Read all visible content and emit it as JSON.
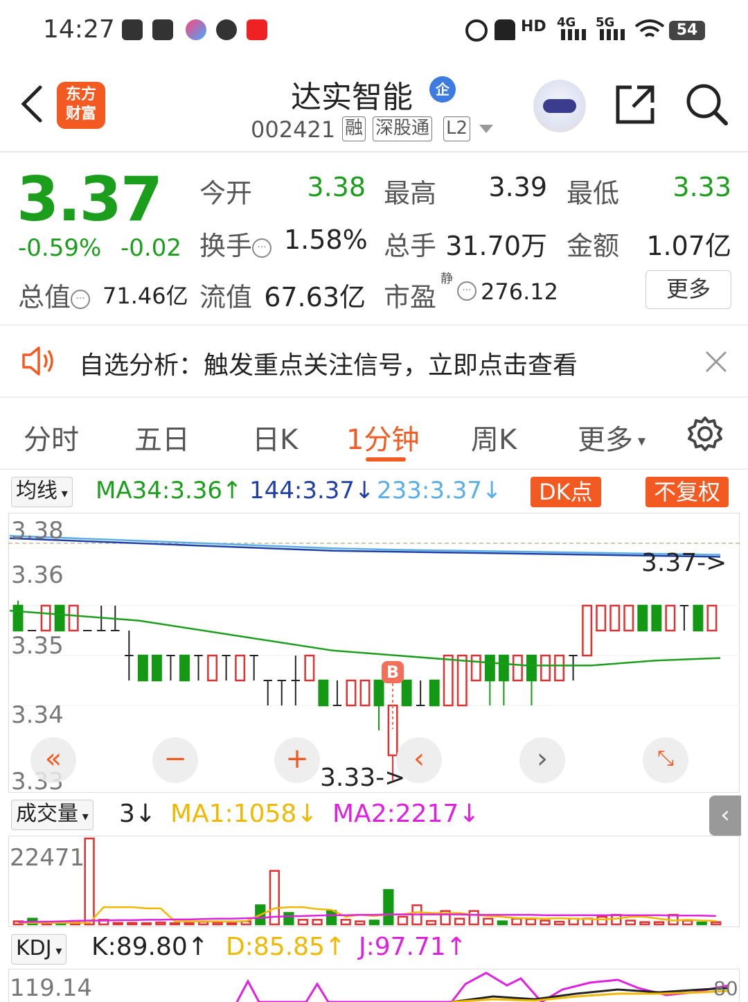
{
  "status_bar": {
    "time": "14:27",
    "battery": "54",
    "network_labels": [
      "HD",
      "4G",
      "5G"
    ],
    "icons": [
      "tiktok-icon",
      "play-icon",
      "cloud-icon",
      "wechat-icon",
      "app-red-icon",
      "alarm-icon",
      "mute-icon",
      "hd-icon",
      "signal-4g-icon",
      "signal-5g-icon",
      "wifi-icon",
      "battery-icon"
    ]
  },
  "header": {
    "logo_text": [
      "东方",
      "财富"
    ],
    "stock_name": "达实智能",
    "enterprise_badge": "企",
    "stock_code": "002421",
    "tags": [
      "融",
      "深股通",
      "L2"
    ],
    "icons": [
      "back-arrow-icon",
      "robot-assistant-icon",
      "share-icon",
      "search-icon"
    ]
  },
  "quote": {
    "price": "3.37",
    "change_pct": "-0.59%",
    "change_amt": "-0.02",
    "open_label": "今开",
    "open": "3.38",
    "high_label": "最高",
    "high": "3.39",
    "low_label": "最低",
    "low": "3.33",
    "turnover_label": "换手",
    "turnover": "1.58%",
    "volume_label": "总手",
    "volume": "31.70万",
    "amount_label": "金额",
    "amount": "1.07亿",
    "mcap_label": "总值",
    "mcap": "71.46亿",
    "float_label": "流值",
    "float_mcap": "67.63亿",
    "pe_label": "市盈",
    "pe_sup": "静",
    "pe": "276.12",
    "more_btn": "更多"
  },
  "notice": {
    "text": "自选分析：触发重点关注信号，立即点击查看",
    "icons": [
      "speaker-icon",
      "close-icon"
    ]
  },
  "tabs": {
    "items": [
      "分时",
      "五日",
      "日K",
      "1分钟",
      "周K",
      "更多"
    ],
    "active": "1分钟",
    "settings_icon": "gear-icon"
  },
  "ma_row": {
    "selector": "均线",
    "ma34": "MA34:3.36↑",
    "ma144": "144:3.37↓",
    "ma233": "233:3.37↓",
    "dk_btn": "DK点",
    "adjust_btn": "不复权",
    "colors": {
      "ma34": "#1b9e1b",
      "ma144": "#1f3ea6",
      "ma233": "#5aaee8",
      "up": "#e03030",
      "down": "#139913",
      "accent": "#f25a22"
    }
  },
  "chart_data": [
    {
      "type": "candlestick",
      "yticks": [
        "3.38",
        "3.36",
        "3.35",
        "3.34",
        "3.33"
      ],
      "ylim": [
        3.33,
        3.38
      ],
      "last_price_label": "3.37->",
      "low_price_label": "3.33->",
      "buy_marker": "B",
      "candles": [
        {
          "o": 3.365,
          "c": 3.36,
          "h": 3.366,
          "l": 3.36
        },
        {
          "o": 3.36,
          "c": 3.36,
          "h": 3.36,
          "l": 3.36
        },
        {
          "o": 3.36,
          "c": 3.365,
          "h": 3.365,
          "l": 3.36
        },
        {
          "o": 3.365,
          "c": 3.36,
          "h": 3.365,
          "l": 3.36
        },
        {
          "o": 3.36,
          "c": 3.365,
          "h": 3.365,
          "l": 3.36
        },
        {
          "o": 3.36,
          "c": 3.36,
          "h": 3.36,
          "l": 3.36
        },
        {
          "o": 3.36,
          "c": 3.36,
          "h": 3.365,
          "l": 3.36
        },
        {
          "o": 3.36,
          "c": 3.36,
          "h": 3.365,
          "l": 3.36
        },
        {
          "o": 3.355,
          "c": 3.355,
          "h": 3.36,
          "l": 3.35
        },
        {
          "o": 3.355,
          "c": 3.35,
          "h": 3.355,
          "l": 3.35
        },
        {
          "o": 3.355,
          "c": 3.35,
          "h": 3.355,
          "l": 3.35
        },
        {
          "o": 3.355,
          "c": 3.355,
          "h": 3.355,
          "l": 3.35
        },
        {
          "o": 3.355,
          "c": 3.35,
          "h": 3.355,
          "l": 3.35
        },
        {
          "o": 3.355,
          "c": 3.355,
          "h": 3.355,
          "l": 3.35
        },
        {
          "o": 3.35,
          "c": 3.355,
          "h": 3.355,
          "l": 3.35
        },
        {
          "o": 3.355,
          "c": 3.355,
          "h": 3.355,
          "l": 3.35
        },
        {
          "o": 3.35,
          "c": 3.355,
          "h": 3.355,
          "l": 3.35
        },
        {
          "o": 3.355,
          "c": 3.355,
          "h": 3.355,
          "l": 3.35
        },
        {
          "o": 3.35,
          "c": 3.35,
          "h": 3.35,
          "l": 3.345
        },
        {
          "o": 3.35,
          "c": 3.35,
          "h": 3.35,
          "l": 3.345
        },
        {
          "o": 3.35,
          "c": 3.35,
          "h": 3.355,
          "l": 3.345
        },
        {
          "o": 3.35,
          "c": 3.355,
          "h": 3.355,
          "l": 3.35
        },
        {
          "o": 3.35,
          "c": 3.345,
          "h": 3.35,
          "l": 3.345
        },
        {
          "o": 3.345,
          "c": 3.345,
          "h": 3.35,
          "l": 3.345
        },
        {
          "o": 3.345,
          "c": 3.35,
          "h": 3.35,
          "l": 3.345
        },
        {
          "o": 3.345,
          "c": 3.35,
          "h": 3.35,
          "l": 3.345
        },
        {
          "o": 3.35,
          "c": 3.345,
          "h": 3.35,
          "l": 3.34
        },
        {
          "o": 3.335,
          "c": 3.345,
          "h": 3.345,
          "l": 3.33
        },
        {
          "o": 3.35,
          "c": 3.345,
          "h": 3.35,
          "l": 3.345
        },
        {
          "o": 3.345,
          "c": 3.345,
          "h": 3.35,
          "l": 3.345
        },
        {
          "o": 3.35,
          "c": 3.345,
          "h": 3.35,
          "l": 3.345
        },
        {
          "o": 3.345,
          "c": 3.355,
          "h": 3.355,
          "l": 3.345
        },
        {
          "o": 3.345,
          "c": 3.355,
          "h": 3.355,
          "l": 3.345
        },
        {
          "o": 3.35,
          "c": 3.355,
          "h": 3.355,
          "l": 3.35
        },
        {
          "o": 3.355,
          "c": 3.35,
          "h": 3.355,
          "l": 3.345
        },
        {
          "o": 3.355,
          "c": 3.35,
          "h": 3.355,
          "l": 3.345
        },
        {
          "o": 3.35,
          "c": 3.355,
          "h": 3.355,
          "l": 3.35
        },
        {
          "o": 3.355,
          "c": 3.35,
          "h": 3.355,
          "l": 3.345
        },
        {
          "o": 3.35,
          "c": 3.355,
          "h": 3.355,
          "l": 3.35
        },
        {
          "o": 3.35,
          "c": 3.355,
          "h": 3.355,
          "l": 3.35
        },
        {
          "o": 3.355,
          "c": 3.355,
          "h": 3.355,
          "l": 3.35
        },
        {
          "o": 3.355,
          "c": 3.365,
          "h": 3.365,
          "l": 3.355
        },
        {
          "o": 3.36,
          "c": 3.365,
          "h": 3.365,
          "l": 3.36
        },
        {
          "o": 3.36,
          "c": 3.365,
          "h": 3.365,
          "l": 3.36
        },
        {
          "o": 3.36,
          "c": 3.365,
          "h": 3.365,
          "l": 3.36
        },
        {
          "o": 3.365,
          "c": 3.36,
          "h": 3.365,
          "l": 3.36
        },
        {
          "o": 3.365,
          "c": 3.36,
          "h": 3.365,
          "l": 3.36
        },
        {
          "o": 3.36,
          "c": 3.365,
          "h": 3.365,
          "l": 3.36
        },
        {
          "o": 3.365,
          "c": 3.365,
          "h": 3.365,
          "l": 3.36
        },
        {
          "o": 3.365,
          "c": 3.36,
          "h": 3.365,
          "l": 3.36
        },
        {
          "o": 3.36,
          "c": 3.365,
          "h": 3.365,
          "l": 3.36
        }
      ],
      "ma34_points": [
        3.364,
        3.363,
        3.362,
        3.36,
        3.358,
        3.356,
        3.355,
        3.354,
        3.353,
        3.353,
        3.354,
        3.3545
      ],
      "ma144_points": [
        3.3785,
        3.378,
        3.3775,
        3.377,
        3.3765,
        3.376,
        3.3758,
        3.3756,
        3.3754,
        3.3752,
        3.375,
        3.3748
      ],
      "ma233_points": [
        3.379,
        3.3785,
        3.378,
        3.3775,
        3.377,
        3.3765,
        3.3762,
        3.376,
        3.3758,
        3.3756,
        3.3754,
        3.3752
      ]
    },
    {
      "type": "bar",
      "title": "成交量",
      "series_label": "3↓",
      "ma1": "MA1:1058↓",
      "ma2": "MA2:2217↓",
      "ymax_label": "22471",
      "ylim": [
        0,
        22471
      ],
      "values": [
        800,
        1500,
        600,
        600,
        900,
        22471,
        1200,
        400,
        400,
        300,
        500,
        300,
        300,
        700,
        500,
        300,
        800,
        5000,
        14000,
        3000,
        1200,
        1200,
        3500,
        1200,
        800,
        1000,
        9000,
        2000,
        5000,
        900,
        3500,
        1500,
        3500,
        1500,
        800,
        1500,
        1400,
        1000,
        700,
        1500,
        1500,
        2000,
        2500,
        1000,
        600,
        600,
        2500,
        1000,
        500,
        600
      ],
      "up": [
        true,
        false,
        true,
        false,
        true,
        true,
        true,
        true,
        true,
        true,
        true,
        true,
        true,
        true,
        true,
        true,
        true,
        false,
        true,
        false,
        true,
        true,
        false,
        true,
        true,
        false,
        false,
        true,
        true,
        true,
        true,
        true,
        true,
        true,
        false,
        true,
        true,
        true,
        true,
        true,
        true,
        true,
        true,
        true,
        true,
        true,
        true,
        true,
        false,
        true
      ],
      "ma1_points": [
        400,
        400,
        400,
        400,
        400,
        400,
        4500,
        4500,
        4500,
        4200,
        4200,
        800,
        800,
        800,
        800,
        800,
        800,
        2500,
        4200,
        4500,
        4500,
        4000,
        3800,
        2000,
        2500,
        2200,
        2600,
        2600,
        3200,
        3000,
        2900,
        3000,
        2500,
        2200,
        2000,
        1600,
        1600,
        1500,
        1600,
        1500,
        1400,
        1300,
        1500,
        2000,
        2000,
        1500,
        1000,
        1200,
        1000,
        900
      ],
      "ma2_points": [
        600,
        700,
        700,
        800,
        900,
        1000,
        1000,
        1100,
        1100,
        1200,
        1200,
        1300,
        1300,
        1400,
        1500,
        1500,
        1600,
        1700,
        2000,
        2100,
        2200,
        2300,
        2400,
        2400,
        2500,
        2500,
        2600,
        2600,
        2600,
        2600,
        2600,
        2600,
        2500,
        2500,
        2500,
        2500,
        2500,
        2400,
        2400,
        2400,
        2400,
        2400,
        2400,
        2400,
        2400,
        2400,
        2300,
        2300,
        2300,
        2200
      ]
    },
    {
      "type": "line",
      "title": "KDJ",
      "k": "K:89.80↑",
      "d": "D:85.85↑",
      "j": "J:97.71↑",
      "ymax_label": "119.14",
      "right_label": "80"
    }
  ],
  "controls": {
    "icons": [
      "rewind-icon",
      "zoom-out-icon",
      "zoom-in-icon",
      "prev-icon",
      "next-icon",
      "fullscreen-icon"
    ],
    "side_tab_icon": "chevron-left-icon"
  }
}
